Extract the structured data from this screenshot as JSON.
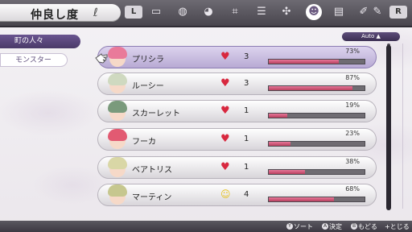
{
  "header": {
    "title": "仲良し度",
    "title_swirl": "ℓ",
    "lb_label": "L",
    "rb_label": "R",
    "menu_icons": [
      {
        "icon": "book-icon",
        "glyph": "▭"
      },
      {
        "icon": "compass-icon",
        "glyph": "◍"
      },
      {
        "icon": "seed-bag-icon",
        "glyph": "◕"
      },
      {
        "icon": "tools-icon",
        "glyph": "⌗"
      },
      {
        "icon": "list-icon",
        "glyph": "☰"
      },
      {
        "icon": "controller-icon",
        "glyph": "✣"
      },
      {
        "icon": "friendship-icon",
        "glyph": "☻",
        "active": true
      },
      {
        "icon": "notebook-icon",
        "glyph": "▤"
      },
      {
        "icon": "feather-icon",
        "glyph": "✐"
      },
      {
        "icon": "wrench-icon",
        "glyph": "✎"
      }
    ]
  },
  "tabs": [
    {
      "label": "町の人々",
      "active": true
    },
    {
      "label": "モンスター",
      "active": false
    }
  ],
  "sort_badge": "Auto ▲",
  "residents": [
    {
      "name": "プリシラ",
      "icon": "heart-icon",
      "level": "3",
      "percent": "73%",
      "progress": 0.73,
      "hair": "#e97a9a",
      "selected": true
    },
    {
      "name": "ルーシー",
      "icon": "heart-icon",
      "level": "3",
      "percent": "87%",
      "progress": 0.87,
      "hair": "#cfd9c0"
    },
    {
      "name": "スカーレット",
      "icon": "heart-icon",
      "level": "1",
      "percent": "19%",
      "progress": 0.19,
      "hair": "#7a9a7c"
    },
    {
      "name": "フーカ",
      "icon": "heart-icon",
      "level": "1",
      "percent": "23%",
      "progress": 0.23,
      "hair": "#e25a72"
    },
    {
      "name": "ベアトリス",
      "icon": "heart-icon",
      "level": "1",
      "percent": "38%",
      "progress": 0.38,
      "hair": "#d9d7a6"
    },
    {
      "name": "マーティン",
      "icon": "smile-icon",
      "level": "4",
      "percent": "68%",
      "progress": 0.68,
      "hair": "#c6c78f"
    }
  ],
  "footer": {
    "hints": [
      {
        "button": "Y",
        "label": "ソート"
      },
      {
        "button": "A",
        "label": "決定"
      },
      {
        "button": "B",
        "label": "もどる"
      },
      {
        "button": "+",
        "label": "とじる"
      }
    ]
  },
  "colors": {
    "accent": "#5a4878",
    "heart": "#d8283f",
    "bar_fill": "#d65c80"
  }
}
